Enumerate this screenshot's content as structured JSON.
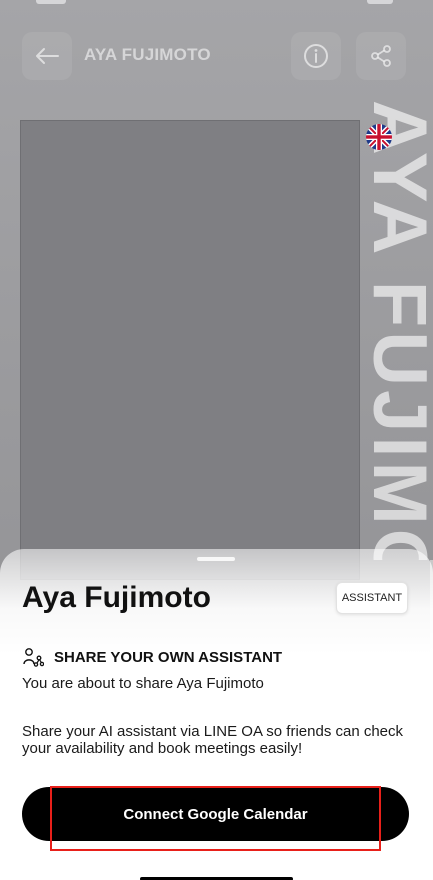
{
  "header": {
    "title": "AYA FUJIMOTO",
    "vertical_watermark": "AYA FUJIMOTO"
  },
  "hero": {
    "photo_placeholder_label": ""
  },
  "sheet": {
    "name": "Aya Fujimoto",
    "badge": "ASSISTANT",
    "share_heading": "SHARE YOUR OWN ASSISTANT",
    "line1": "You are about to share Aya Fujimoto",
    "paragraph": "Share your AI assistant via LINE OA so friends can check your availability and book meetings easily!",
    "cta_label": "Connect Google Calendar"
  },
  "icons": {
    "back": "arrow-left-icon",
    "info": "info-icon",
    "share": "share-icon",
    "flag": "uk-flag-icon",
    "share_assistant": "share-nodes-icon"
  },
  "colors": {
    "cta_bg": "#000000",
    "cta_text": "#ffffff",
    "highlight": "#e8201a"
  }
}
